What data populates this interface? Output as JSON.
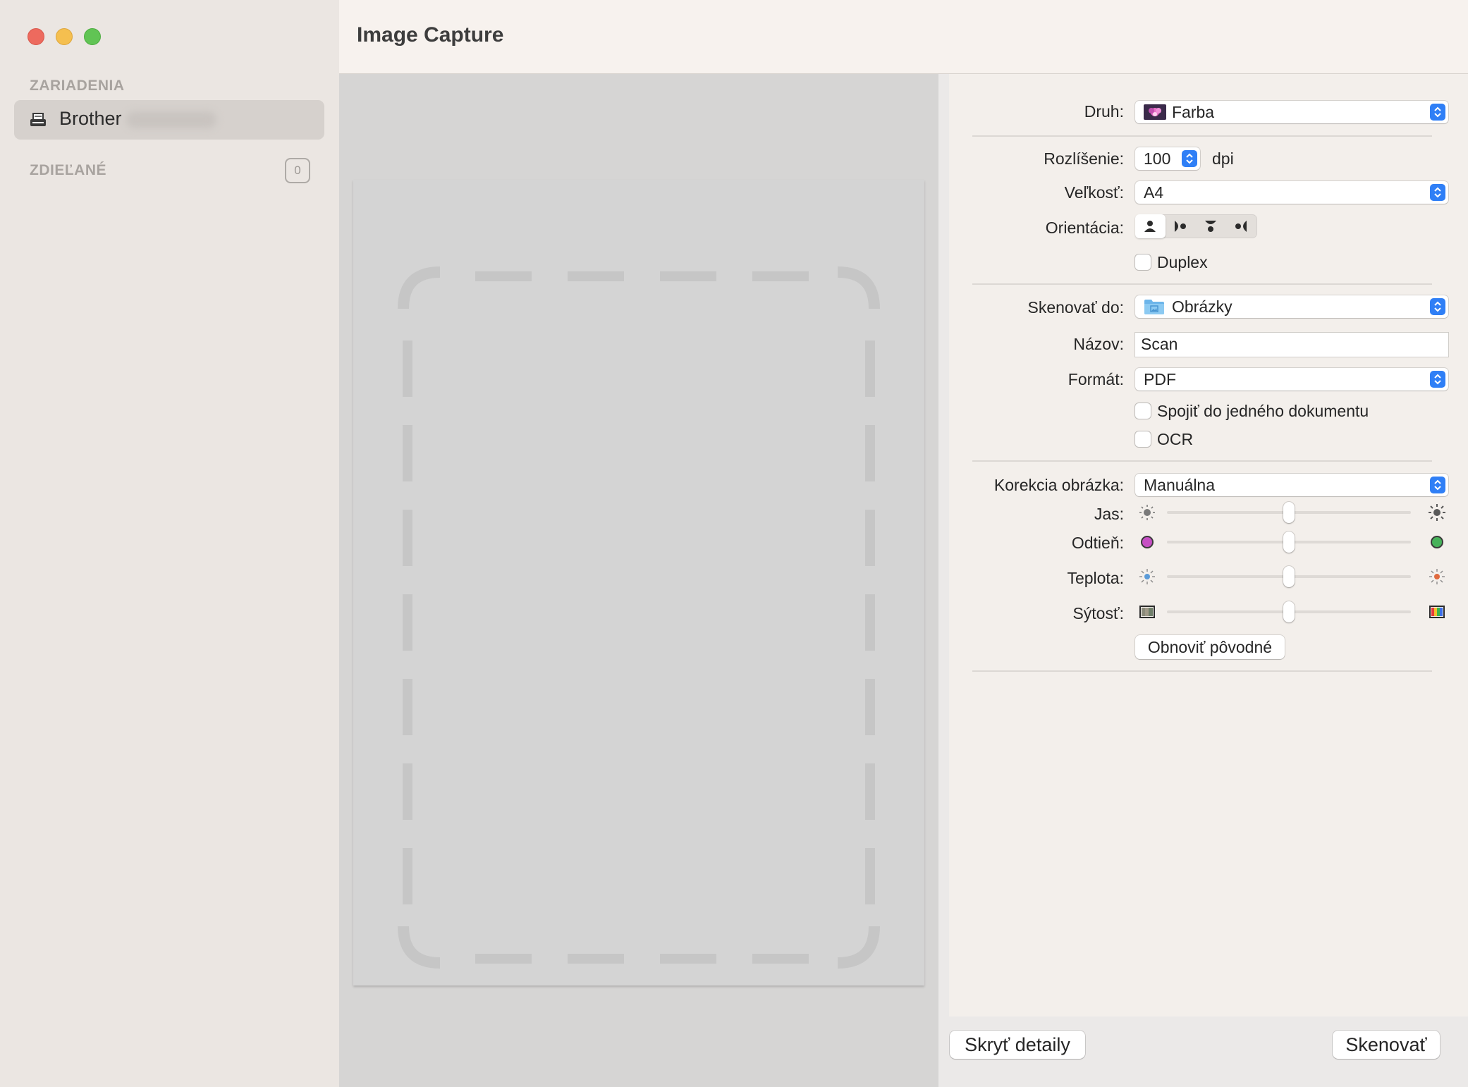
{
  "window": {
    "title": "Image Capture"
  },
  "sidebar": {
    "devices_header": "ZARIADENIA",
    "device": {
      "name": "Brother"
    },
    "shared_header": "ZDIEĽANÉ",
    "shared_count": "0"
  },
  "details": {
    "druh": {
      "label": "Druh:",
      "value": "Farba"
    },
    "resolution": {
      "label": "Rozlíšenie:",
      "value": "100",
      "unit": "dpi"
    },
    "size": {
      "label": "Veľkosť:",
      "value": "A4"
    },
    "orientation": {
      "label": "Orientácia:",
      "selected_index": 0
    },
    "duplex": {
      "label": "Duplex",
      "checked": false
    },
    "scan_to": {
      "label": "Skenovať do:",
      "value": "Obrázky"
    },
    "name": {
      "label": "Názov:",
      "value": "Scan"
    },
    "format": {
      "label": "Formát:",
      "value": "PDF"
    },
    "combine": {
      "label": "Spojiť do jedného dokumentu",
      "checked": false
    },
    "ocr": {
      "label": "OCR",
      "checked": false
    },
    "correction": {
      "label": "Korekcia obrázka:",
      "value": "Manuálna"
    },
    "sliders": [
      {
        "label": "Jas:",
        "value": 0.5
      },
      {
        "label": "Odtieň:",
        "value": 0.5
      },
      {
        "label": "Teplota:",
        "value": 0.5
      },
      {
        "label": "Sýtosť:",
        "value": 0.5
      }
    ],
    "reset_button": "Obnoviť pôvodné"
  },
  "footer": {
    "hide_details_button": "Skryť detaily",
    "scan_button": "Skenovať"
  },
  "colors": {
    "accent": "#2f7ff6",
    "close": "#ed6a5e",
    "minimize": "#f5bf4f",
    "zoom": "#61c454"
  }
}
